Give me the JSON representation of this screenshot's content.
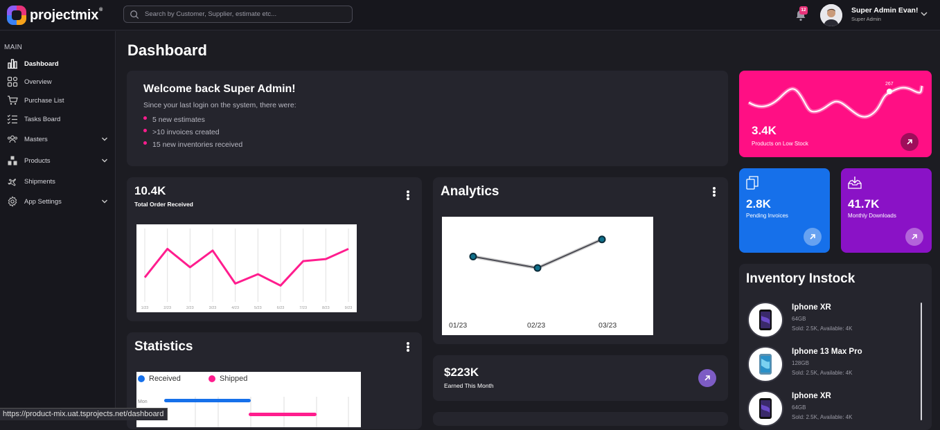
{
  "app": {
    "logo_text": "projectmix",
    "logo_reg": "®"
  },
  "search": {
    "placeholder": "Search by Customer, Supplier, estimate etc..."
  },
  "notifications": {
    "count": "12"
  },
  "user": {
    "name": "Super Admin Evan!",
    "role": "Super Admin"
  },
  "sidebar": {
    "heading": "MAIN",
    "items": [
      {
        "label": "Dashboard",
        "icon": "bar-chart-icon"
      },
      {
        "label": "Overview",
        "icon": "grid-icon"
      },
      {
        "label": "Purchase List",
        "icon": "cart-icon"
      },
      {
        "label": "Tasks Board",
        "icon": "checklist-icon"
      },
      {
        "label": "Masters",
        "icon": "users-icon"
      },
      {
        "label": "Products",
        "icon": "boxes-icon"
      },
      {
        "label": "Shipments",
        "icon": "airplane-icon"
      },
      {
        "label": "App Settings",
        "icon": "gear-icon"
      }
    ]
  },
  "page": {
    "title": "Dashboard"
  },
  "welcome": {
    "title": "Welcome back Super Admin!",
    "intro": "Since your last login on the system, there were:",
    "bullets": [
      "5 new estimates",
      ">10 invoices created",
      "15 new inventories received"
    ]
  },
  "orders": {
    "value": "10.4K",
    "label": "Total Order Received"
  },
  "analytics": {
    "title": "Analytics"
  },
  "statistics": {
    "title": "Statistics",
    "legend": [
      "Received",
      "Shipped"
    ],
    "row_label": "Mon"
  },
  "earned": {
    "value": "$223K",
    "label": "Earned This Month"
  },
  "low_stock": {
    "value": "3.4K",
    "label": "Products on Low Stock",
    "peak_label": "267"
  },
  "pending": {
    "value": "2.8K",
    "label": "Pending Invoices"
  },
  "downloads": {
    "value": "41.7K",
    "label": "Monthly Downloads"
  },
  "inventory": {
    "title": "Inventory Instock",
    "items": [
      {
        "name": "Iphone XR",
        "spec": "64GB",
        "sold": "Sold: 2.5K, Available: 4K"
      },
      {
        "name": "Iphone 13 Max Pro",
        "spec": "128GB",
        "sold": "Sold: 2.5K, Available: 4K"
      },
      {
        "name": "Iphone XR",
        "spec": "64GB",
        "sold": "Sold: 2.5K, Available: 4K"
      }
    ]
  },
  "status_bar": {
    "url": "https://product-mix.uat.tsprojects.net/dashboard"
  },
  "colors": {
    "pink": "#ff1d8e",
    "blue": "#1670ea",
    "purple": "#8a12c6",
    "bg": "#1c1c22",
    "card": "#25252d"
  },
  "chart_data": [
    {
      "type": "line",
      "x": [
        "1/23",
        "2/23",
        "2/23",
        "3/23",
        "4/23",
        "5/23",
        "6/23",
        "7/23",
        "8/23",
        "9/23"
      ],
      "series": [
        {
          "values": [
            2,
            9,
            4.5,
            8.6,
            0.5,
            2.8,
            0,
            6,
            6.5,
            9
          ]
        }
      ],
      "ylim": [
        -4,
        14
      ],
      "grid": true
    },
    {
      "type": "line",
      "x": [
        "01/23",
        "02/23",
        "03/23"
      ],
      "series": [
        {
          "values": [
            4,
            2,
            7
          ]
        }
      ],
      "ylim": [
        -6,
        10
      ]
    }
  ]
}
